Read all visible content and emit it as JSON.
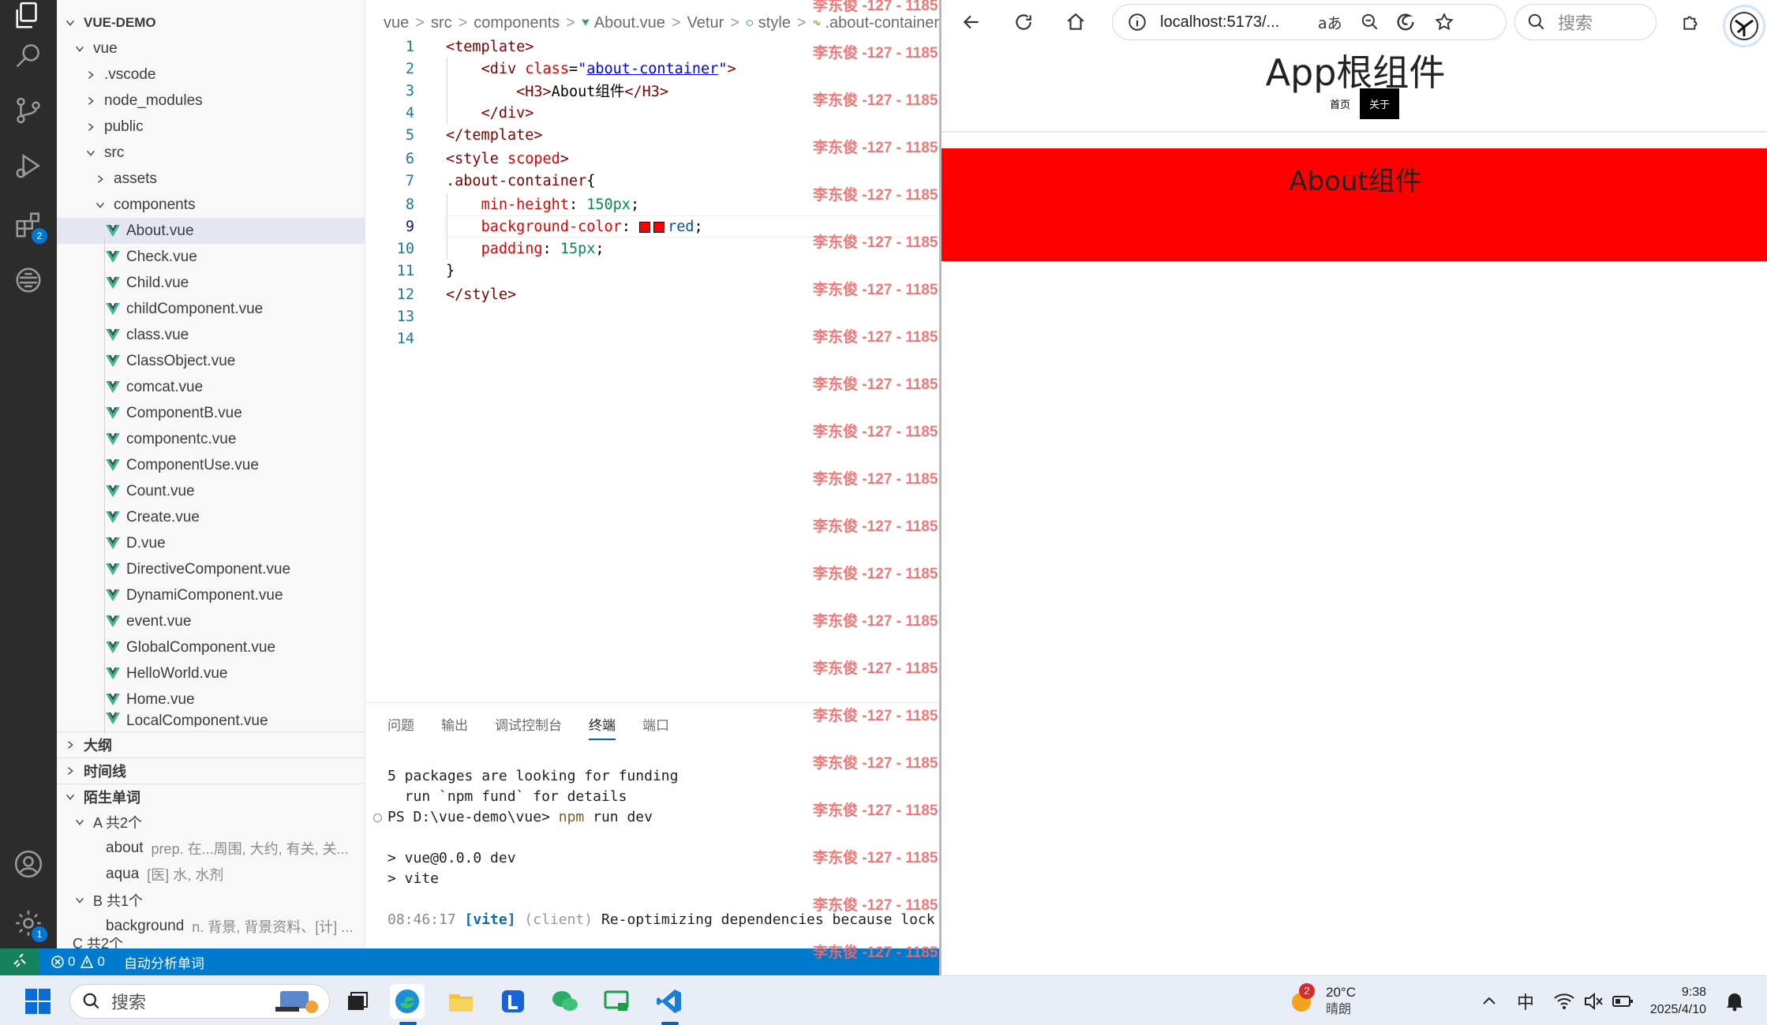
{
  "explorer": {
    "root": "VUE-DEMO",
    "items": [
      {
        "label": "vue",
        "level": 1,
        "type": "folder",
        "open": true
      },
      {
        "label": ".vscode",
        "level": 2,
        "type": "folder",
        "open": false
      },
      {
        "label": "node_modules",
        "level": 2,
        "type": "folder",
        "open": false
      },
      {
        "label": "public",
        "level": 2,
        "type": "folder",
        "open": false
      },
      {
        "label": "src",
        "level": 2,
        "type": "folder",
        "open": true
      },
      {
        "label": "assets",
        "level": 3,
        "type": "folder",
        "open": false
      },
      {
        "label": "components",
        "level": 3,
        "type": "folder",
        "open": true
      },
      {
        "label": "About.vue",
        "level": 4,
        "type": "vue",
        "selected": true
      },
      {
        "label": "Check.vue",
        "level": 4,
        "type": "vue"
      },
      {
        "label": "Child.vue",
        "level": 4,
        "type": "vue"
      },
      {
        "label": "childComponent.vue",
        "level": 4,
        "type": "vue"
      },
      {
        "label": "class.vue",
        "level": 4,
        "type": "vue"
      },
      {
        "label": "ClassObject.vue",
        "level": 4,
        "type": "vue"
      },
      {
        "label": "comcat.vue",
        "level": 4,
        "type": "vue"
      },
      {
        "label": "ComponentB.vue",
        "level": 4,
        "type": "vue"
      },
      {
        "label": "componentc.vue",
        "level": 4,
        "type": "vue"
      },
      {
        "label": "ComponentUse.vue",
        "level": 4,
        "type": "vue"
      },
      {
        "label": "Count.vue",
        "level": 4,
        "type": "vue"
      },
      {
        "label": "Create.vue",
        "level": 4,
        "type": "vue"
      },
      {
        "label": "D.vue",
        "level": 4,
        "type": "vue"
      },
      {
        "label": "DirectiveComponent.vue",
        "level": 4,
        "type": "vue"
      },
      {
        "label": "DynamiComponent.vue",
        "level": 4,
        "type": "vue"
      },
      {
        "label": "event.vue",
        "level": 4,
        "type": "vue"
      },
      {
        "label": "GlobalComponent.vue",
        "level": 4,
        "type": "vue"
      },
      {
        "label": "HelloWorld.vue",
        "level": 4,
        "type": "vue"
      },
      {
        "label": "Home.vue",
        "level": 4,
        "type": "vue"
      },
      {
        "label": "LocalComponent.vue",
        "level": 4,
        "type": "vue"
      }
    ],
    "sections": {
      "outline": "大纲",
      "timeline": "时间线",
      "words": "陌生单词"
    },
    "words": {
      "group_a": "A 共2个",
      "about_word": "about",
      "about_def": "prep. 在...周围, 大约, 有关, 关...",
      "aqua_word": "aqua",
      "aqua_def": "[医] 水, 水剂",
      "group_b": "B 共1个",
      "background_word": "background",
      "background_def": "n. 背景, 背景资料、[计] ...",
      "group_c": "C 共2个"
    }
  },
  "activity": {
    "extensions_badge": "2",
    "settings_badge": "1"
  },
  "breadcrumb": {
    "items": [
      "vue",
      "src",
      "components",
      "About.vue",
      "Vetur",
      "style",
      ".about-container"
    ]
  },
  "editor": {
    "active_line": 9,
    "line_numbers": [
      "1",
      "2",
      "3",
      "4",
      "5",
      "6",
      "7",
      "8",
      "9",
      "10",
      "11",
      "12",
      "13",
      "14"
    ]
  },
  "panel": {
    "tabs": [
      "问题",
      "输出",
      "调试控制台",
      "终端",
      "端口"
    ],
    "active_tab": "终端",
    "terminal_lines": [
      "5 packages are looking for funding",
      "  run `npm fund` for details",
      "PS D:\\vue-demo\\vue> npm run dev",
      "",
      "> vue@0.0.0 dev",
      "> vite",
      "",
      "08:46:17 [vite] (client) Re-optimizing dependencies because lock"
    ]
  },
  "statusbar": {
    "errors": "0",
    "warnings": "0",
    "task": "自动分析单词"
  },
  "watermark": {
    "text": "李东俊 -127 - 1185"
  },
  "browser": {
    "url": "localhost:5173/...",
    "search_placeholder": "搜索",
    "app_title": "App根组件",
    "nav_home": "首页",
    "nav_about": "关于",
    "about_heading": "About组件",
    "about_bg": "#ff0000"
  },
  "taskbar": {
    "search_placeholder": "搜索",
    "weather_temp": "20°C",
    "weather_desc": "晴朗",
    "weather_badge": "2",
    "ime": "中",
    "time": "9:38",
    "date": "2025/4/10"
  }
}
